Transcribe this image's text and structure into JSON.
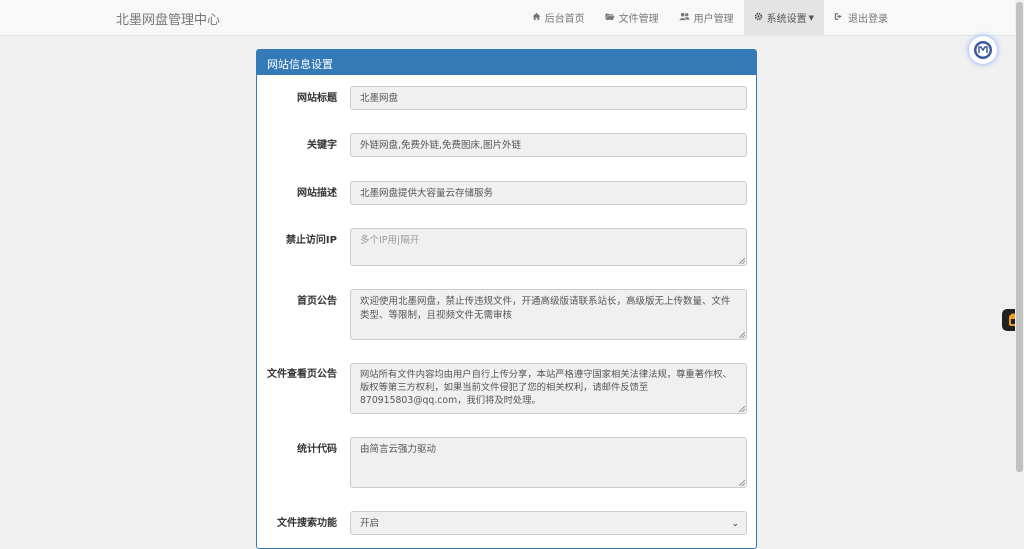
{
  "navbar": {
    "brand": "北墨网盘管理中心",
    "items": [
      {
        "label": "后台首页",
        "icon": "home-icon"
      },
      {
        "label": "文件管理",
        "icon": "folder-open-icon"
      },
      {
        "label": "用户管理",
        "icon": "users-icon"
      },
      {
        "label": "系统设置",
        "icon": "gear-icon"
      },
      {
        "label": "退出登录",
        "icon": "sign-out-icon"
      }
    ]
  },
  "panel": {
    "title": "网站信息设置",
    "fields": {
      "site_title": {
        "label": "网站标题",
        "value": "北墨网盘"
      },
      "keywords": {
        "label": "关键字",
        "value": "外链网盘,免费外链,免费图床,图片外链"
      },
      "description": {
        "label": "网站描述",
        "value": "北墨网盘提供大容量云存储服务"
      },
      "blocked_ip": {
        "label": "禁止访问IP",
        "placeholder": "多个IP用|隔开"
      },
      "home_notice": {
        "label": "首页公告",
        "value": "欢迎使用北墨网盘，禁止传违规文件，开通高级版请联系站长，高级版无上传数量、文件类型、等限制，且视频文件无需审核"
      },
      "file_notice": {
        "label": "文件查看页公告",
        "value": "网站所有文件内容均由用户自行上传分享，本站严格遵守国家相关法律法规，尊重著作权、版权等第三方权利，如果当前文件侵犯了您的相关权利，请邮件反馈至870915803@qq.com，我们将及时处理。"
      },
      "stats_code": {
        "label": "统计代码",
        "value": "由简言云强力驱动"
      },
      "search": {
        "label": "文件搜索功能",
        "value": "开启"
      }
    }
  }
}
